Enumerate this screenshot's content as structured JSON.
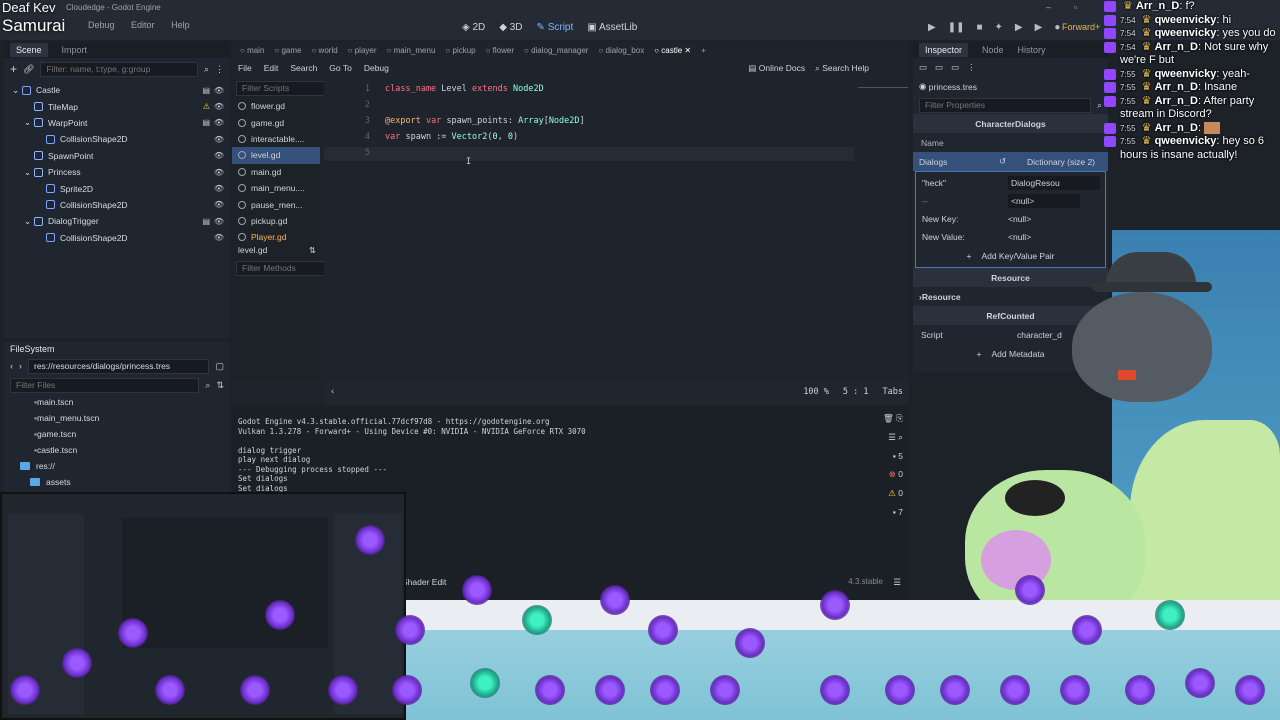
{
  "streamer_overlay": {
    "line1": "Deaf Kev",
    "line2": "Samurai"
  },
  "window": {
    "title": "Cloudedge - Godot Engine",
    "menus": [
      "Debug",
      "Editor",
      "Help"
    ]
  },
  "workspaces": {
    "w2d": "2D",
    "w3d": "3D",
    "script": "Script",
    "assetlib": "AssetLib",
    "renderer": "Forward+"
  },
  "scene_panel": {
    "tabs": [
      "Scene",
      "Import"
    ],
    "filter_placeholder": "Filter: name, t:type, g:group",
    "nodes": [
      {
        "label": "Castle",
        "depth": 0
      },
      {
        "label": "TileMap",
        "depth": 1
      },
      {
        "label": "WarpPoint",
        "depth": 1
      },
      {
        "label": "CollisionShape2D",
        "depth": 2
      },
      {
        "label": "SpawnPoint",
        "depth": 1
      },
      {
        "label": "Princess",
        "depth": 1
      },
      {
        "label": "Sprite2D",
        "depth": 2
      },
      {
        "label": "CollisionShape2D",
        "depth": 2
      },
      {
        "label": "DialogTrigger",
        "depth": 1
      },
      {
        "label": "CollisionShape2D",
        "depth": 2
      }
    ]
  },
  "filesystem": {
    "title": "FileSystem",
    "path": "res://resources/dialogs/princess.tres",
    "filter_placeholder": "Filter Files",
    "items": [
      "main.tscn",
      "main_menu.tscn",
      "game.tscn",
      "castle.tscn",
      "res://",
      "assets"
    ]
  },
  "scene_tabs": [
    "main",
    "game",
    "world",
    "player",
    "main_menu",
    "pickup",
    "flower",
    "dialog_manager",
    "dialog_box",
    "castle"
  ],
  "script_menu": [
    "File",
    "Edit",
    "Search",
    "Go To",
    "Debug"
  ],
  "script_toolbar": {
    "online_docs": "Online Docs",
    "search_help": "Search Help"
  },
  "script_list": {
    "filter_placeholder": "Filter Scripts",
    "items": [
      "flower.gd",
      "game.gd",
      "interactable....",
      "level.gd",
      "main.gd",
      "main_menu....",
      "pause_men...",
      "pickup.gd",
      "Player.gd"
    ],
    "current": "level.gd",
    "filter_methods": "Filter Methods"
  },
  "code": [
    {
      "n": "1",
      "parts": [
        [
          "kw",
          "class_name "
        ],
        [
          "tx",
          "Level "
        ],
        [
          "kw",
          "extends "
        ],
        [
          "ty",
          "Node2D"
        ]
      ]
    },
    {
      "n": "2",
      "parts": []
    },
    {
      "n": "3",
      "parts": [
        [
          "an",
          "@export "
        ],
        [
          "kw",
          "var "
        ],
        [
          "tx",
          "spawn_points: "
        ],
        [
          "ty",
          "Array"
        ],
        [
          "tx",
          "["
        ],
        [
          "ty",
          "Node2D"
        ],
        [
          "tx",
          "]"
        ]
      ]
    },
    {
      "n": "4",
      "parts": [
        [
          "kw",
          "var "
        ],
        [
          "tx",
          "spawn := "
        ],
        [
          "ty",
          "Vector2"
        ],
        [
          "tx",
          "("
        ],
        [
          "nm",
          "0"
        ],
        [
          "tx",
          ", "
        ],
        [
          "nm",
          "0"
        ],
        [
          "tx",
          ")"
        ]
      ]
    },
    {
      "n": "5",
      "parts": []
    }
  ],
  "editor_status": {
    "zoom": "100 %",
    "line": "5",
    "col": "1",
    "indent": "Tabs"
  },
  "output": {
    "lines": [
      "Godot Engine v4.3.stable.official.77dcf97d8 - https://godotengine.org",
      "Vulkan 1.3.278 - Forward+ - Using Device #0: NVIDIA - NVIDIA GeForce RTX 3070",
      "",
      "dialog trigger",
      "play next dialog",
      "--- Debugging process stopped ---",
      "Set dialogs",
      "Set dialogs"
    ],
    "counts": {
      "log": "5",
      "errors": "0",
      "warnings": "0",
      "messages": "7"
    },
    "bottom_tabs": {
      "shader_editor": "Shader Edit",
      "version": "4.3.stable"
    }
  },
  "inspector": {
    "tabs": [
      "Inspector",
      "Node",
      "History"
    ],
    "resource_file": "princess.tres",
    "filter_placeholder": "Filter Properties",
    "class_name": "CharacterDialogs",
    "name_label": "Name",
    "dialogs_label": "Dialogs",
    "dialogs_value": "Dictionary (size 2)",
    "key1": "\"heck\"",
    "value1": "DialogResou",
    "null_label": "<null>",
    "new_key": "New Key:",
    "new_value": "New Value:",
    "add_pair": "Add Key/Value Pair",
    "resource_section": "Resource",
    "resource_group": "Resource",
    "refcounted": "RefCounted",
    "script_label": "Script",
    "script_value": "character_d",
    "add_metadata": "Add Metadata"
  },
  "chat": [
    {
      "time": "",
      "user": "Arr_n_D",
      "msg": "f?"
    },
    {
      "time": "7:54",
      "user": "qweenvicky",
      "msg": "hi"
    },
    {
      "time": "7:54",
      "user": "qweenvicky",
      "msg": "yes you do"
    },
    {
      "time": "7:54",
      "user": "Arr_n_D",
      "msg": "Not sure why we're F but"
    },
    {
      "time": "7:55",
      "user": "qweenvicky",
      "msg": "yeah-"
    },
    {
      "time": "7:55",
      "user": "Arr_n_D",
      "msg": "Insane"
    },
    {
      "time": "7:55",
      "user": "Arr_n_D",
      "msg": "After party stream in Discord?"
    },
    {
      "time": "7:55",
      "user": "Arr_n_D",
      "msg": ""
    },
    {
      "time": "7:55",
      "user": "qweenvicky",
      "msg": "hey so 6 hours is insane actually!"
    }
  ],
  "colors": {
    "accent": "#478cbf",
    "bg": "#1d2229",
    "panel": "#202630",
    "twitch": "#9146ff",
    "gem_purple": "#8e4cf0",
    "gem_green": "#2fd6a8"
  }
}
